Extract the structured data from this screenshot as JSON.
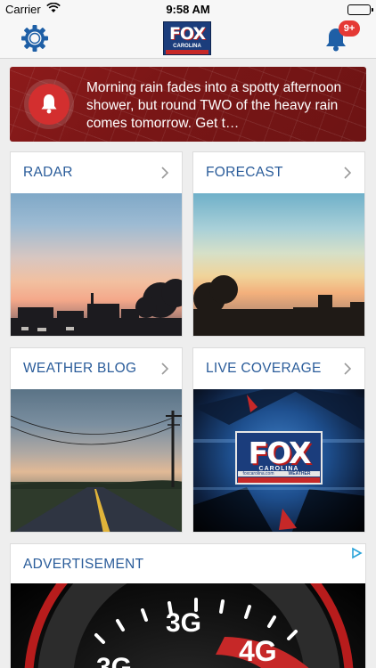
{
  "status_bar": {
    "carrier": "Carrier",
    "time": "9:58 AM"
  },
  "nav": {
    "logo_text": "FOX",
    "logo_subtext": "CAROLINA",
    "notification_badge": "9+"
  },
  "alert": {
    "message": "Morning rain fades into a spotty afternoon shower, but round TWO of the heavy rain comes tomorrow. Get t…"
  },
  "tiles": [
    {
      "label": "RADAR"
    },
    {
      "label": "FORECAST"
    },
    {
      "label": "WEATHER BLOG"
    },
    {
      "label": "LIVE COVERAGE"
    }
  ],
  "live_logo": {
    "text": "FOX",
    "sub": "CAROLINA",
    "url": "foxcarolina.com",
    "tag": "WEATHER"
  },
  "ad": {
    "label": "ADVERTISEMENT",
    "gauge_labels": [
      "3G",
      "4G"
    ]
  },
  "colors": {
    "accent": "#2a5c9a",
    "alert_red": "#8d1b1b",
    "badge_red": "#e53935",
    "icon_blue": "#1e5fa6"
  }
}
